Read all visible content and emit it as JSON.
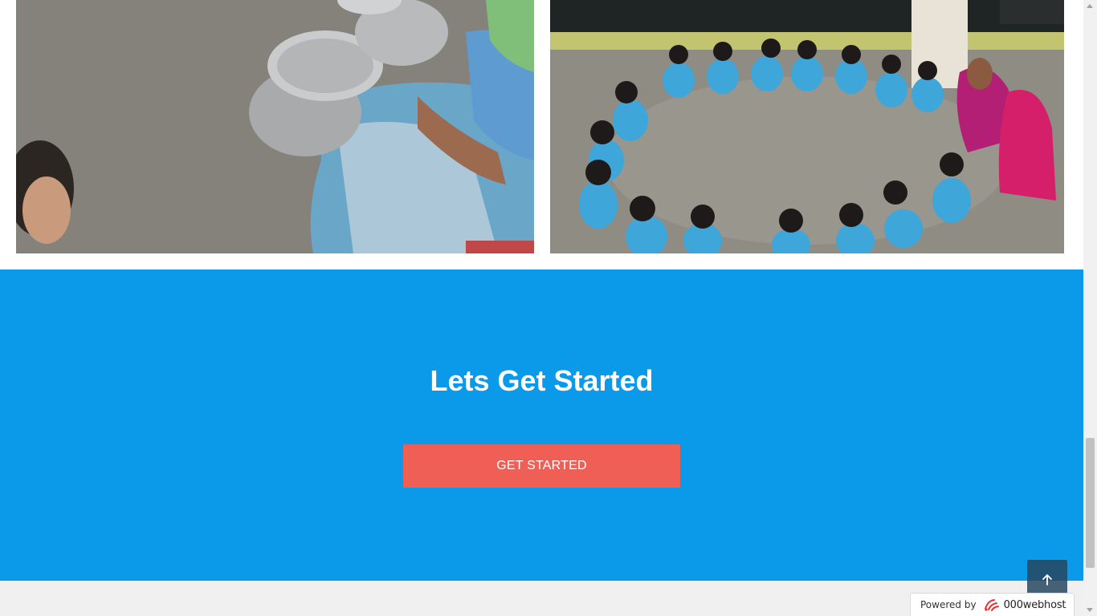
{
  "gallery": {
    "images": [
      {
        "name": "photo-cooking-pots",
        "alt": ""
      },
      {
        "name": "photo-children-eating",
        "alt": ""
      }
    ]
  },
  "cta": {
    "title": "Lets Get Started",
    "button_label": "GET STARTED",
    "background_color": "#0b9aea",
    "button_color": "#f05f55"
  },
  "scroll_to_top": {
    "icon": "arrow-up-icon"
  },
  "badge": {
    "label": "Powered by",
    "brand": "000webhost",
    "icon": "000webhost-logo-icon"
  }
}
